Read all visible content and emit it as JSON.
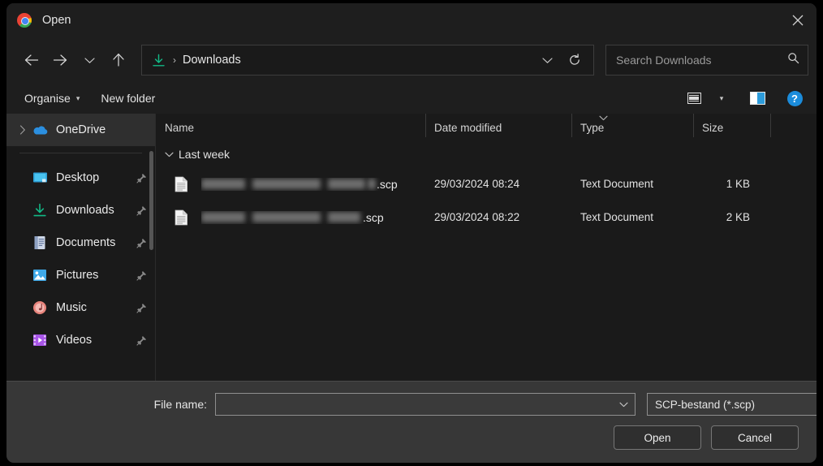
{
  "window": {
    "title": "Open",
    "app_icon": "chrome-logo",
    "close_label": "✕"
  },
  "nav": {
    "back": "back-arrow",
    "forward": "forward-arrow",
    "recent": "chevron-down",
    "up": "up-arrow"
  },
  "address": {
    "icon": "downloads-icon",
    "separator": "›",
    "label": "Downloads",
    "dropdown": "chevron-down-icon",
    "refresh": "refresh-icon"
  },
  "search": {
    "placeholder": "Search Downloads",
    "value": "",
    "icon": "search-icon"
  },
  "commandbar": {
    "organise": "Organise",
    "organise_caret": "▾",
    "new_folder": "New folder",
    "view_icon": "layout-view-icon",
    "view_caret": "▾",
    "preview_pane_icon": "preview-pane-icon",
    "help_icon": "?"
  },
  "sidebar": {
    "onedrive": {
      "label": "OneDrive",
      "icon": "onedrive-cloud-icon",
      "expander": "›",
      "selected": true
    },
    "items": [
      {
        "label": "Desktop",
        "icon": "desktop-icon",
        "pinned": true
      },
      {
        "label": "Downloads",
        "icon": "downloads-icon",
        "pinned": true
      },
      {
        "label": "Documents",
        "icon": "documents-icon",
        "pinned": true
      },
      {
        "label": "Pictures",
        "icon": "pictures-icon",
        "pinned": true
      },
      {
        "label": "Music",
        "icon": "music-icon",
        "pinned": true
      },
      {
        "label": "Videos",
        "icon": "videos-icon",
        "pinned": true
      }
    ]
  },
  "filelist": {
    "columns": [
      {
        "key": "name",
        "label": "Name"
      },
      {
        "key": "date",
        "label": "Date modified"
      },
      {
        "key": "type",
        "label": "Type"
      },
      {
        "key": "size",
        "label": "Size"
      }
    ],
    "sort_indicator": "chevron-down-icon",
    "group": {
      "label": "Last week",
      "chevron": "chevron-down-icon",
      "expanded": true
    },
    "rows": [
      {
        "icon": "text-document-icon",
        "name_redacted": true,
        "name_suffix": ".scp",
        "date": "29/03/2024 08:24",
        "type": "Text Document",
        "size": "1 KB"
      },
      {
        "icon": "text-document-icon",
        "name_redacted": true,
        "name_suffix": ".scp",
        "date": "29/03/2024 08:22",
        "type": "Text Document",
        "size": "2 KB"
      }
    ]
  },
  "footer": {
    "filename_label": "File name:",
    "filename_value": "",
    "filename_placeholder": "",
    "filetype_value": "SCP-bestand (*.scp)",
    "filetype_caret": "chevron-down-icon",
    "open_label": "Open",
    "cancel_label": "Cancel"
  },
  "colors": {
    "window_bg": "#1e1e1e",
    "content_bg": "#1a1a1a",
    "footer_bg": "#373737",
    "accent_blue": "#1b8cdb",
    "downloads_green": "#12b886",
    "selection": "#2f2f2f"
  }
}
